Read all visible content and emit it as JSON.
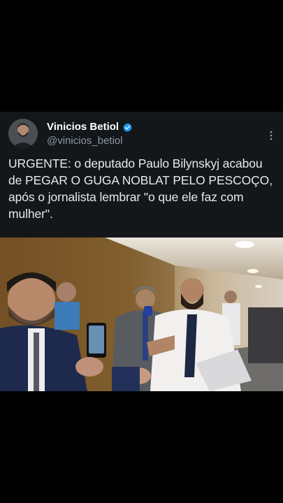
{
  "tweet": {
    "author": {
      "display_name": "Vinicios Betiol",
      "handle": "@vinicios_betiol",
      "verified": true
    },
    "text": "URGENTE: o deputado Paulo Bilynskyj acabou de PEGAR O GUGA NOBLAT PELO PESCOÇO, após o jornalista lembrar \"o que ele faz com mulher\".",
    "media": {
      "type": "video-frame"
    }
  },
  "icons": {
    "verified": "verified-badge-icon",
    "more": "more-options-icon"
  },
  "colors": {
    "background": "#000000",
    "card": "#14171a",
    "text": "#e7e9ea",
    "muted": "#8b98a5",
    "verified": "#1d9bf0"
  }
}
